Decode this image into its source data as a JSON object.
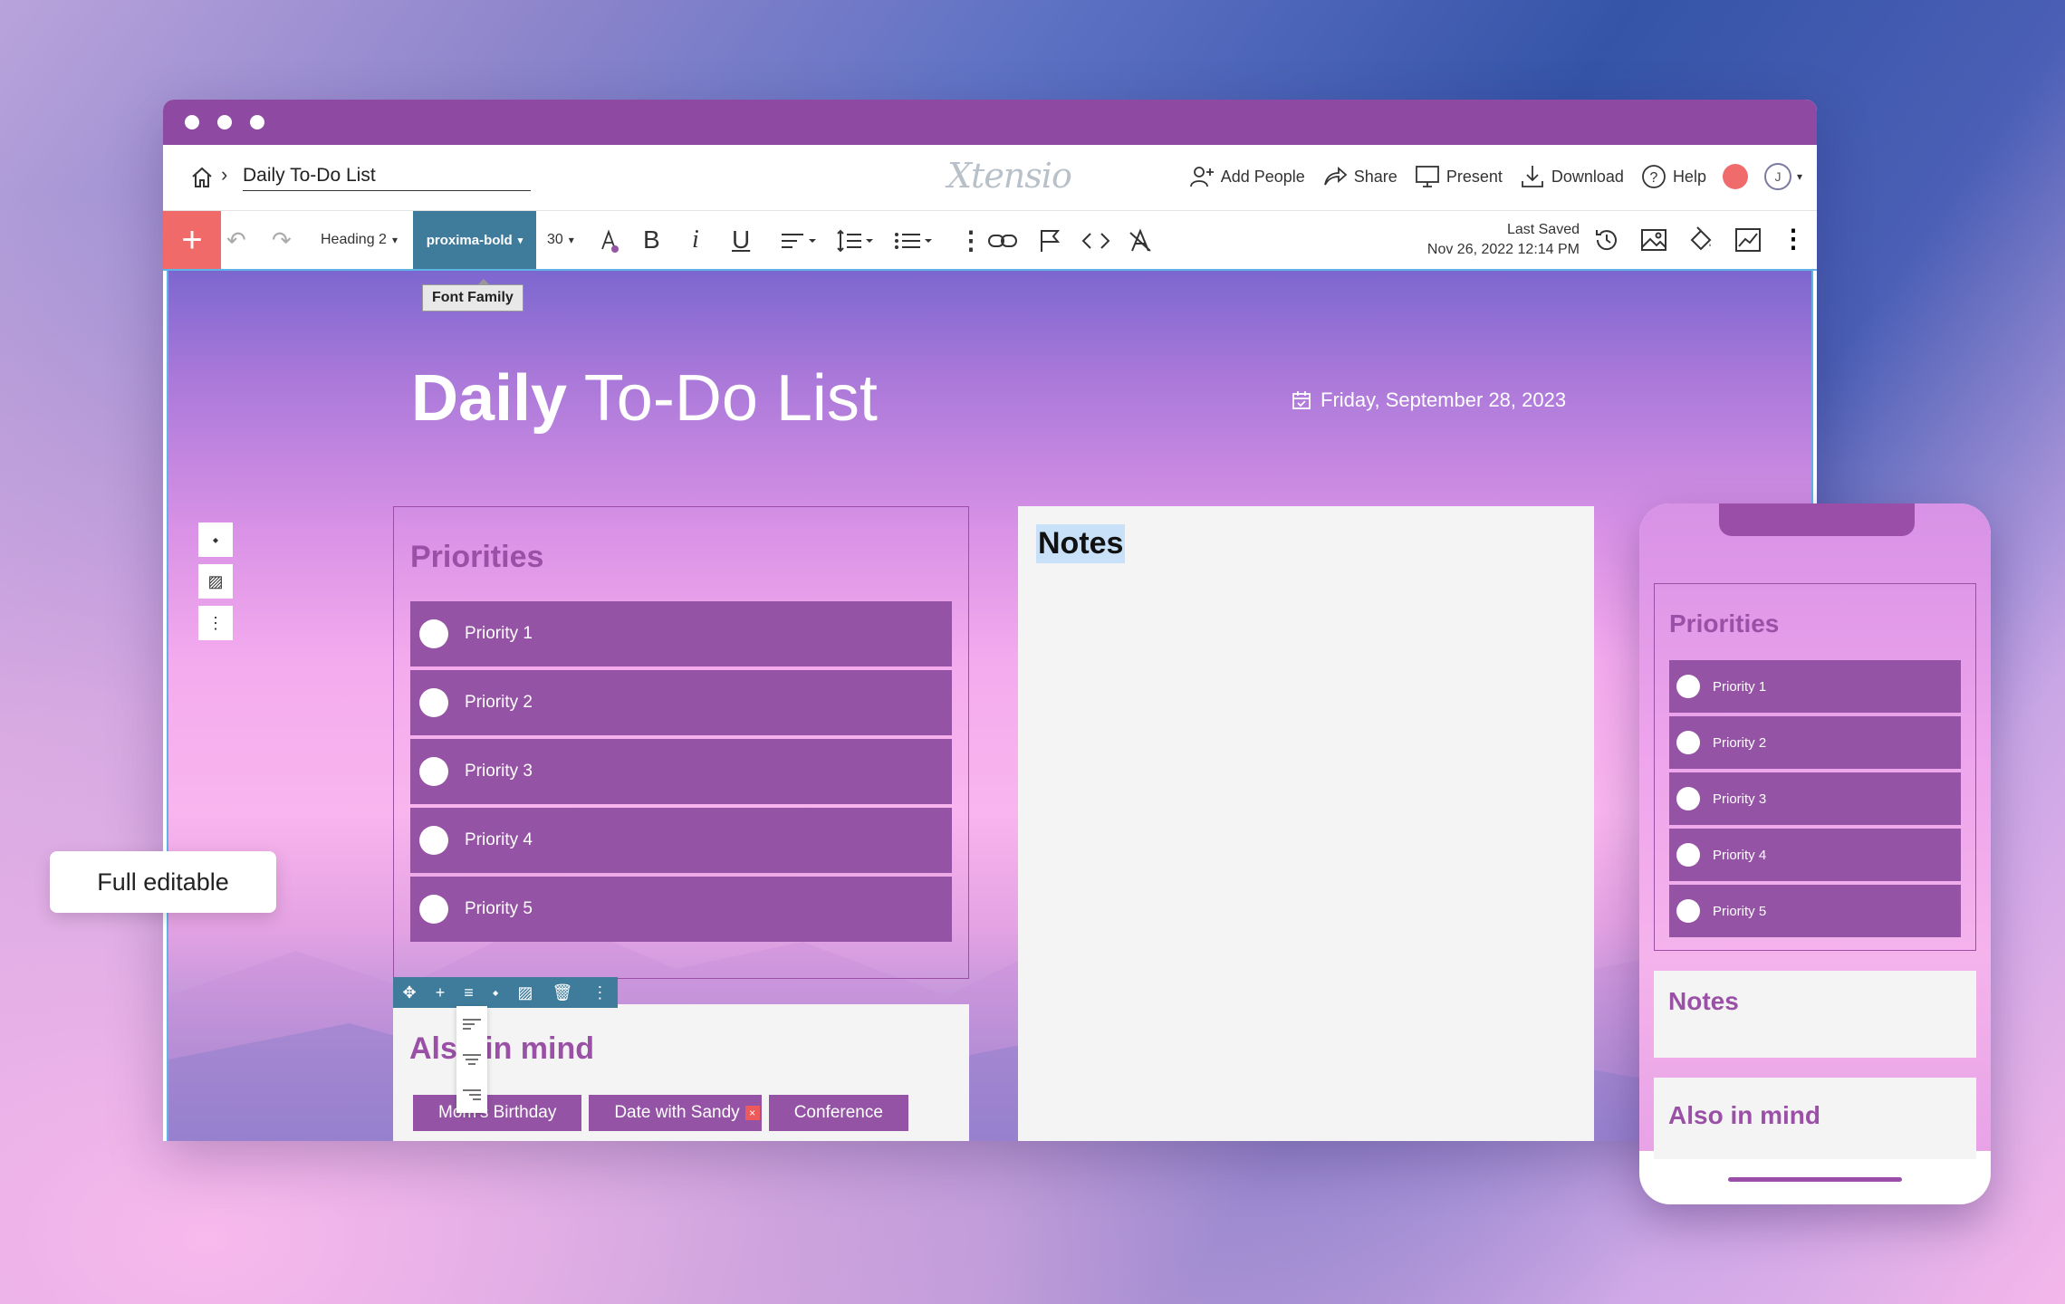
{
  "breadcrumb": {
    "title": "Daily To-Do List"
  },
  "logo": "Xtensio",
  "menu": {
    "add_people": "Add People",
    "share": "Share",
    "present": "Present",
    "download": "Download",
    "help": "Help",
    "avatar_initial": "J"
  },
  "toolbar": {
    "add": "+",
    "text_style": "Heading 2",
    "font_family": "proxima-bold",
    "font_size": "30",
    "tooltip": "Font Family",
    "last_saved_label": "Last Saved",
    "last_saved_time": "Nov 26, 2022 12:14 PM"
  },
  "page": {
    "title_bold": "Daily",
    "title_rest": "To-Do List",
    "date": "Friday, September 28, 2023"
  },
  "priorities": {
    "title": "Priorities",
    "items": [
      "Priority 1",
      "Priority 2",
      "Priority 3",
      "Priority 4",
      "Priority 5"
    ]
  },
  "notes": {
    "title": "Notes"
  },
  "also": {
    "title": "Also in mind",
    "tags": [
      "Mom's Birthday",
      "Date with Sandy",
      "Conference"
    ]
  },
  "badge": "Full editable",
  "phone": {
    "priorities_title": "Priorities",
    "items": [
      "Priority 1",
      "Priority 2",
      "Priority 3",
      "Priority 4",
      "Priority 5"
    ],
    "notes_title": "Notes",
    "also_title": "Also in mind"
  },
  "colors": {
    "brand": "#8e4aa2",
    "accent": "#3f7c9c",
    "add": "#f06a6a",
    "item": "#9453a4"
  }
}
